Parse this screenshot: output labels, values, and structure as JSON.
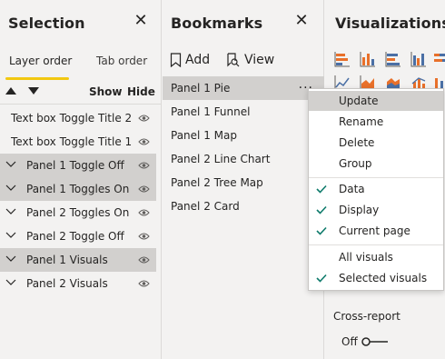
{
  "selection": {
    "title": "Selection",
    "close": "✕",
    "tabs": {
      "active": "Layer order",
      "inactive": "Tab order"
    },
    "show_label": "Show",
    "hide_label": "Hide",
    "items": [
      {
        "label": "Text box Toggle Title 2",
        "group": false,
        "selected": false
      },
      {
        "label": "Text box Toggle Title 1",
        "group": false,
        "selected": false
      },
      {
        "label": "Panel 1 Toggle Off",
        "group": true,
        "selected": true
      },
      {
        "label": "Panel 1 Toggles On",
        "group": true,
        "selected": true
      },
      {
        "label": "Panel 2 Toggles On",
        "group": true,
        "selected": false
      },
      {
        "label": "Panel 2 Toggle Off",
        "group": true,
        "selected": false
      },
      {
        "label": "Panel 1 Visuals",
        "group": true,
        "selected": true
      },
      {
        "label": "Panel 2 Visuals",
        "group": true,
        "selected": false
      }
    ]
  },
  "bookmarks": {
    "title": "Bookmarks",
    "close": "✕",
    "add_label": "Add",
    "view_label": "View",
    "items": [
      {
        "label": "Panel 1 Pie",
        "selected": true
      },
      {
        "label": "Panel 1 Funnel",
        "selected": false
      },
      {
        "label": "Panel 1 Map",
        "selected": false
      },
      {
        "label": "Panel 2 Line Chart",
        "selected": false
      },
      {
        "label": "Panel 2 Tree Map",
        "selected": false
      },
      {
        "label": "Panel 2 Card",
        "selected": false
      }
    ],
    "more": "···"
  },
  "visualizations": {
    "title": "Visualizations",
    "cross_report": "Cross-report",
    "off_label": "Off"
  },
  "context_menu": {
    "items": [
      {
        "label": "Update",
        "checked": false,
        "highlight": true
      },
      {
        "label": "Rename",
        "checked": false,
        "highlight": false
      },
      {
        "label": "Delete",
        "checked": false,
        "highlight": false
      },
      {
        "label": "Group",
        "checked": false,
        "highlight": false
      },
      {
        "label": "Data",
        "checked": true,
        "highlight": false
      },
      {
        "label": "Display",
        "checked": true,
        "highlight": false
      },
      {
        "label": "Current page",
        "checked": true,
        "highlight": false
      },
      {
        "label": "All visuals",
        "checked": false,
        "highlight": false
      },
      {
        "label": "Selected visuals",
        "checked": true,
        "highlight": false
      }
    ]
  },
  "colors": {
    "accent": "#f2c811",
    "check": "#0f7b6c",
    "selected_row": "#d2d0ce",
    "pane_bg": "#f3f2f1"
  }
}
